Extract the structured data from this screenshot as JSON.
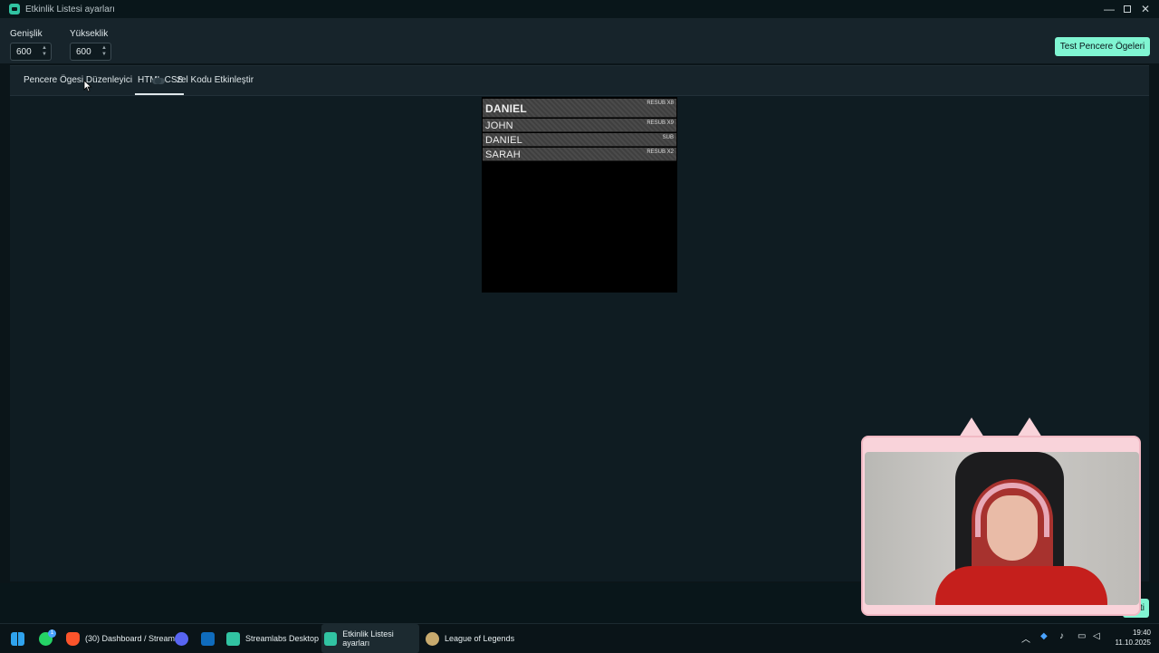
{
  "window": {
    "title": "Etkinlik Listesi ayarları"
  },
  "dimensions": {
    "width_label": "Genişlik",
    "width_value": "600",
    "height_label": "Yükseklik",
    "height_value": "600"
  },
  "buttons": {
    "test": "Test Pencere Ögeleri",
    "done": "ti"
  },
  "tabs": {
    "editor": "Pencere Ögesi Düzenleyici",
    "html": "HTML CSS",
    "custom": "zel Kodu Etkinleştir"
  },
  "events": [
    {
      "name": "DANIEL",
      "type": "RESUB X8"
    },
    {
      "name": "JOHN",
      "type": "RESUB X9"
    },
    {
      "name": "DANIEL",
      "type": "SUB"
    },
    {
      "name": "SARAH",
      "type": "RESUB X2"
    }
  ],
  "taskbar": {
    "whatsapp_badge": "1",
    "brave": "(30) Dashboard / Stream",
    "streamlabs": "Streamlabs Desktop",
    "etkinlik": "Etkinlik Listesi ayarları",
    "league": "League of Legends"
  },
  "clock": {
    "time": "19:40",
    "date": "11.10.2025"
  }
}
